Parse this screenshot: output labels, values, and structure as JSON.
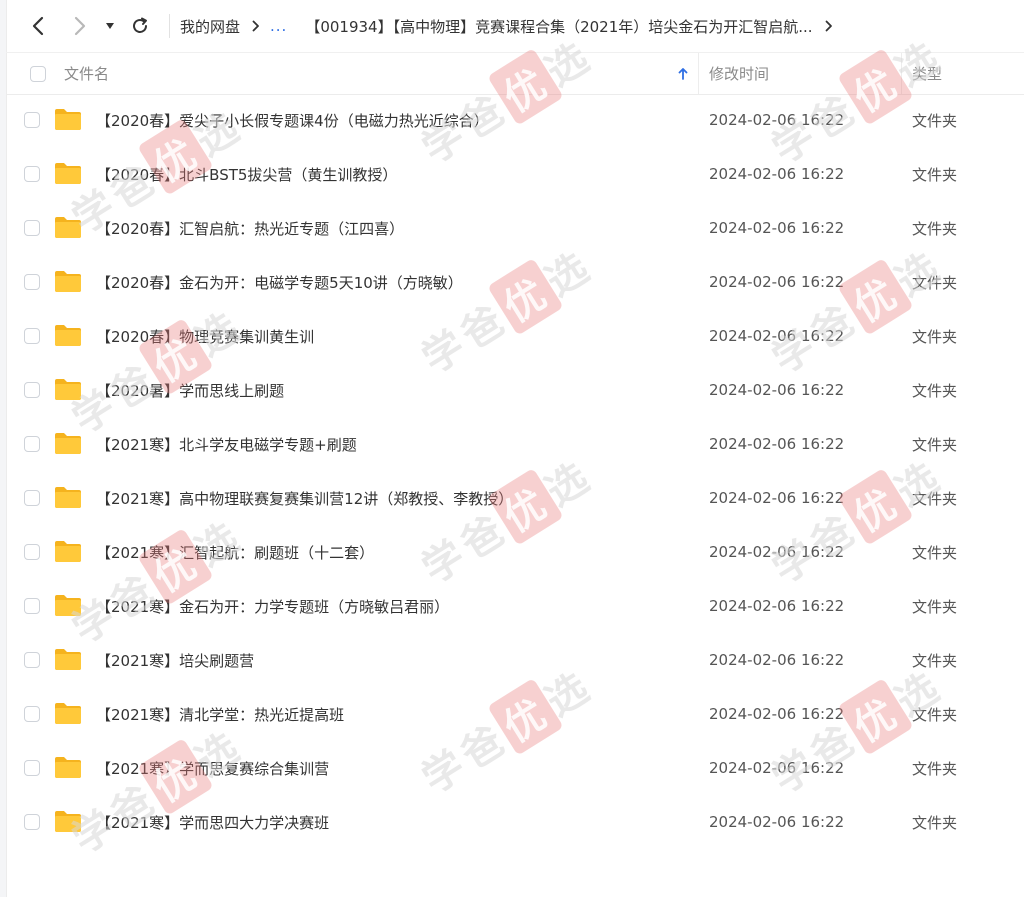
{
  "nav": {
    "back_icon": "chevron-left-icon",
    "forward_icon": "chevron-right-icon",
    "history_icon": "caret-down-icon",
    "refresh_icon": "refresh-icon"
  },
  "breadcrumb": {
    "root": "我的网盘",
    "ellipsis": "...",
    "current": "【001934】【高中物理】竞赛课程合集（2021年）培尖金石为开汇智启航..."
  },
  "columns": {
    "name": "文件名",
    "modified": "修改时间",
    "type": "类型",
    "sort_icon": "arrow-up-icon"
  },
  "colors": {
    "accent": "#2f6fe4",
    "folder": "#ffc93a",
    "folder_tab": "#f5b31e"
  },
  "watermark": {
    "text_prefix": "学爸",
    "text_badge": "优",
    "text_suffix": "选"
  },
  "files": [
    {
      "name": "【2020春】爱尖子小长假专题课4份（电磁力热光近综合）",
      "modified": "2024-02-06 16:22",
      "type": "文件夹"
    },
    {
      "name": "【2020春】北斗BST5拔尖营（黄生训教授）",
      "modified": "2024-02-06 16:22",
      "type": "文件夹"
    },
    {
      "name": "【2020春】汇智启航：热光近专题（江四喜）",
      "modified": "2024-02-06 16:22",
      "type": "文件夹"
    },
    {
      "name": "【2020春】金石为开：电磁学专题5天10讲（方晓敏）",
      "modified": "2024-02-06 16:22",
      "type": "文件夹"
    },
    {
      "name": "【2020春】物理竞赛集训黄生训",
      "modified": "2024-02-06 16:22",
      "type": "文件夹"
    },
    {
      "name": "【2020暑】学而思线上刷题",
      "modified": "2024-02-06 16:22",
      "type": "文件夹"
    },
    {
      "name": "【2021寒】北斗学友电磁学专题+刷题",
      "modified": "2024-02-06 16:22",
      "type": "文件夹"
    },
    {
      "name": "【2021寒】高中物理联赛复赛集训营12讲（郑教授、李教授）",
      "modified": "2024-02-06 16:22",
      "type": "文件夹"
    },
    {
      "name": "【2021寒】汇智起航：刷题班（十二套）",
      "modified": "2024-02-06 16:22",
      "type": "文件夹"
    },
    {
      "name": "【2021寒】金石为开：力学专题班（方晓敏吕君丽）",
      "modified": "2024-02-06 16:22",
      "type": "文件夹"
    },
    {
      "name": "【2021寒】培尖刷题营",
      "modified": "2024-02-06 16:22",
      "type": "文件夹"
    },
    {
      "name": "【2021寒】清北学堂：热光近提高班",
      "modified": "2024-02-06 16:22",
      "type": "文件夹"
    },
    {
      "name": "【2021寒】学而思复赛综合集训营",
      "modified": "2024-02-06 16:22",
      "type": "文件夹"
    },
    {
      "name": "【2021寒】学而思四大力学决赛班",
      "modified": "2024-02-06 16:22",
      "type": "文件夹"
    }
  ]
}
